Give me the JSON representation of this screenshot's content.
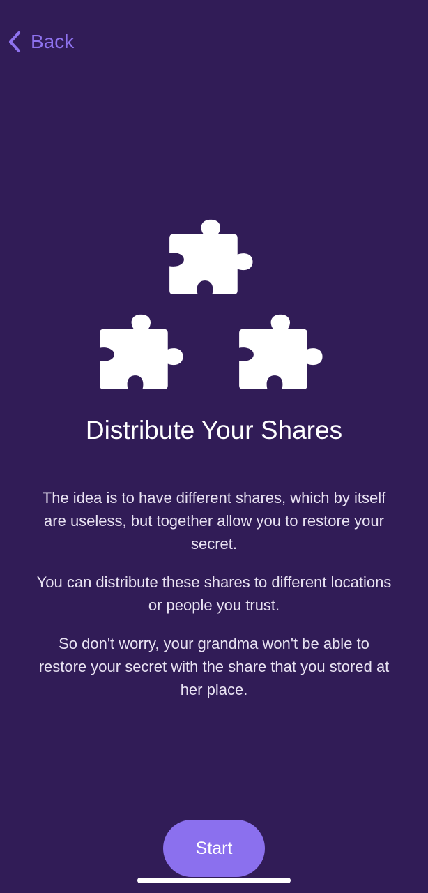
{
  "nav": {
    "back_label": "Back",
    "back_icon": "chevron-left-icon"
  },
  "illustration": {
    "icon": "puzzle-piece-icon",
    "count": 3
  },
  "title": "Distribute Your Shares",
  "paragraphs": [
    "The idea is to have different shares, which by itself are useless, but together allow you to restore your secret.",
    "You can distribute these shares to different locations or people you trust.",
    "So don't worry, your grandma won't be able to restore your secret with the share that you stored at her place."
  ],
  "start_button": {
    "label": "Start"
  },
  "colors": {
    "background": "#311c57",
    "accent": "#8b70ee",
    "text": "#ffffff"
  }
}
